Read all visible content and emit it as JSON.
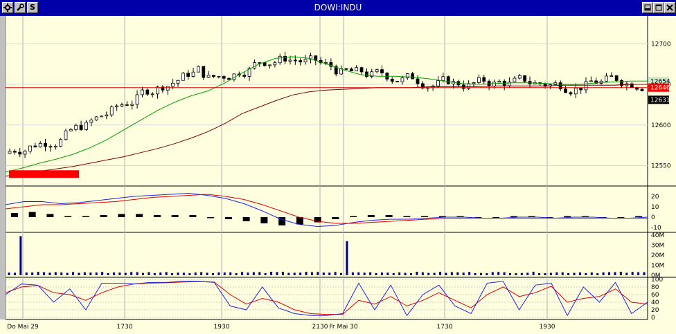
{
  "window": {
    "title": "DOWI:INDU",
    "left_buttons": [
      "settings",
      "wrench",
      "S"
    ],
    "right_buttons": [
      "minimize",
      "maximize",
      "close"
    ],
    "s_label": "S"
  },
  "colors": {
    "background": "#ffffe0",
    "up": "#ffffff",
    "down": "#000000",
    "ma_fast": "#00a000",
    "ma_slow": "#800000",
    "price_line": "#e00000",
    "macd": "#2020e0",
    "signal": "#e00000",
    "volume": "#000080",
    "stoch_k": "#2020e0",
    "stoch_d": "#e00000",
    "label_red": "#ff0000",
    "label_black": "#000000",
    "label_green": "#ffffff"
  },
  "chart_data": [
    {
      "panel": "price",
      "type": "candlestick",
      "ylim": [
        12530,
        12730
      ],
      "yticks": [
        "12550",
        "12600",
        "12650",
        "12700"
      ],
      "ytick_values": [
        12550,
        12600,
        12650,
        12700
      ],
      "xticks": [
        "Do Mai 29",
        "1730",
        "1930",
        "2130",
        "Fr Mai 30",
        "1730",
        "1930"
      ],
      "horizontal_line": 12646,
      "price_labels": [
        {
          "text": "12654",
          "value": 12654,
          "style": "green"
        },
        {
          "text": "12646",
          "value": 12646,
          "style": "red"
        },
        {
          "text": "12631",
          "value": 12631,
          "style": "black"
        }
      ],
      "ma_fast": [
        12542,
        12547,
        12553,
        12558,
        12564,
        12572,
        12582,
        12594,
        12606,
        12618,
        12628,
        12636,
        12642,
        12652,
        12664,
        12675,
        12682,
        12684,
        12682,
        12675,
        12668,
        12662,
        12660,
        12660,
        12659,
        12657,
        12654,
        12651,
        12650,
        12651,
        12652,
        12652,
        12651,
        12650,
        12650,
        12652,
        12653,
        12654,
        12654
      ],
      "ma_slow": [
        12537,
        12540,
        12543,
        12546,
        12549,
        12553,
        12557,
        12561,
        12566,
        12571,
        12577,
        12584,
        12592,
        12602,
        12614,
        12622,
        12630,
        12637,
        12641,
        12643,
        12644,
        12645,
        12646,
        12646,
        12646,
        12647,
        12647,
        12647,
        12647,
        12648,
        12648,
        12648,
        12648,
        12649,
        12649,
        12649,
        12649,
        12650,
        12650
      ],
      "note": "overlay"
    },
    {
      "panel": "macd",
      "type": "line",
      "ylim": [
        -12,
        28
      ],
      "yticks": [
        "20",
        "10",
        "0",
        "-10"
      ],
      "ytick_values": [
        20,
        10,
        0,
        -10
      ],
      "macd": [
        12,
        15,
        15,
        13,
        14,
        16,
        18,
        20,
        21,
        22,
        23,
        21,
        18,
        13,
        6,
        -2,
        -7,
        -9,
        -8,
        -5,
        -3,
        -2,
        -2,
        -1,
        0,
        0,
        -1,
        -1,
        0,
        0,
        -1,
        0,
        0,
        -1,
        -1,
        0
      ],
      "signal": [
        8,
        10,
        12,
        12,
        13,
        14,
        15,
        17,
        19,
        20,
        21,
        22,
        20,
        17,
        12,
        6,
        0,
        -4,
        -6,
        -6,
        -5,
        -4,
        -3,
        -2,
        -1,
        -1,
        -1,
        -1,
        -1,
        -1,
        -1,
        -1,
        -1,
        -1,
        -1,
        -1
      ],
      "histogram": [
        4,
        5,
        3,
        1,
        1,
        2,
        3,
        3,
        2,
        2,
        2,
        -1,
        -2,
        -4,
        -6,
        -8,
        -7,
        -5,
        -2,
        1,
        2,
        2,
        1,
        1,
        1,
        1,
        0,
        0,
        1,
        1,
        0,
        1,
        1,
        0,
        0,
        1
      ]
    },
    {
      "panel": "volume",
      "type": "bar",
      "ylim": [
        0,
        40
      ],
      "yticks": [
        "40M",
        "30M",
        "20M",
        "10M",
        "0M"
      ],
      "ytick_values": [
        40,
        30,
        20,
        10,
        0
      ],
      "spikes": [
        {
          "label": "Do Mai 29 open",
          "value": 39
        },
        {
          "label": "Fr Mai 30 open",
          "value": 34
        }
      ],
      "typical_value": 2
    },
    {
      "panel": "stochastic",
      "type": "line",
      "ylim": [
        0,
        100
      ],
      "yticks": [
        "100",
        "80",
        "60",
        "40",
        "20",
        "0"
      ],
      "ytick_values": [
        100,
        80,
        60,
        40,
        20,
        0
      ],
      "k": [
        60,
        88,
        85,
        40,
        75,
        20,
        90,
        90,
        88,
        92,
        92,
        95,
        95,
        92,
        30,
        20,
        80,
        25,
        10,
        5,
        5,
        10,
        90,
        20,
        85,
        5,
        60,
        85,
        30,
        10,
        90,
        95,
        20,
        85,
        90,
        5,
        80,
        40,
        92,
        10,
        40
      ],
      "d": [
        65,
        80,
        84,
        65,
        60,
        45,
        65,
        80,
        88,
        90,
        91,
        93,
        94,
        93,
        60,
        35,
        50,
        40,
        20,
        10,
        8,
        8,
        45,
        35,
        55,
        30,
        45,
        65,
        45,
        25,
        60,
        80,
        55,
        65,
        82,
        40,
        50,
        55,
        75,
        40,
        35
      ]
    }
  ]
}
